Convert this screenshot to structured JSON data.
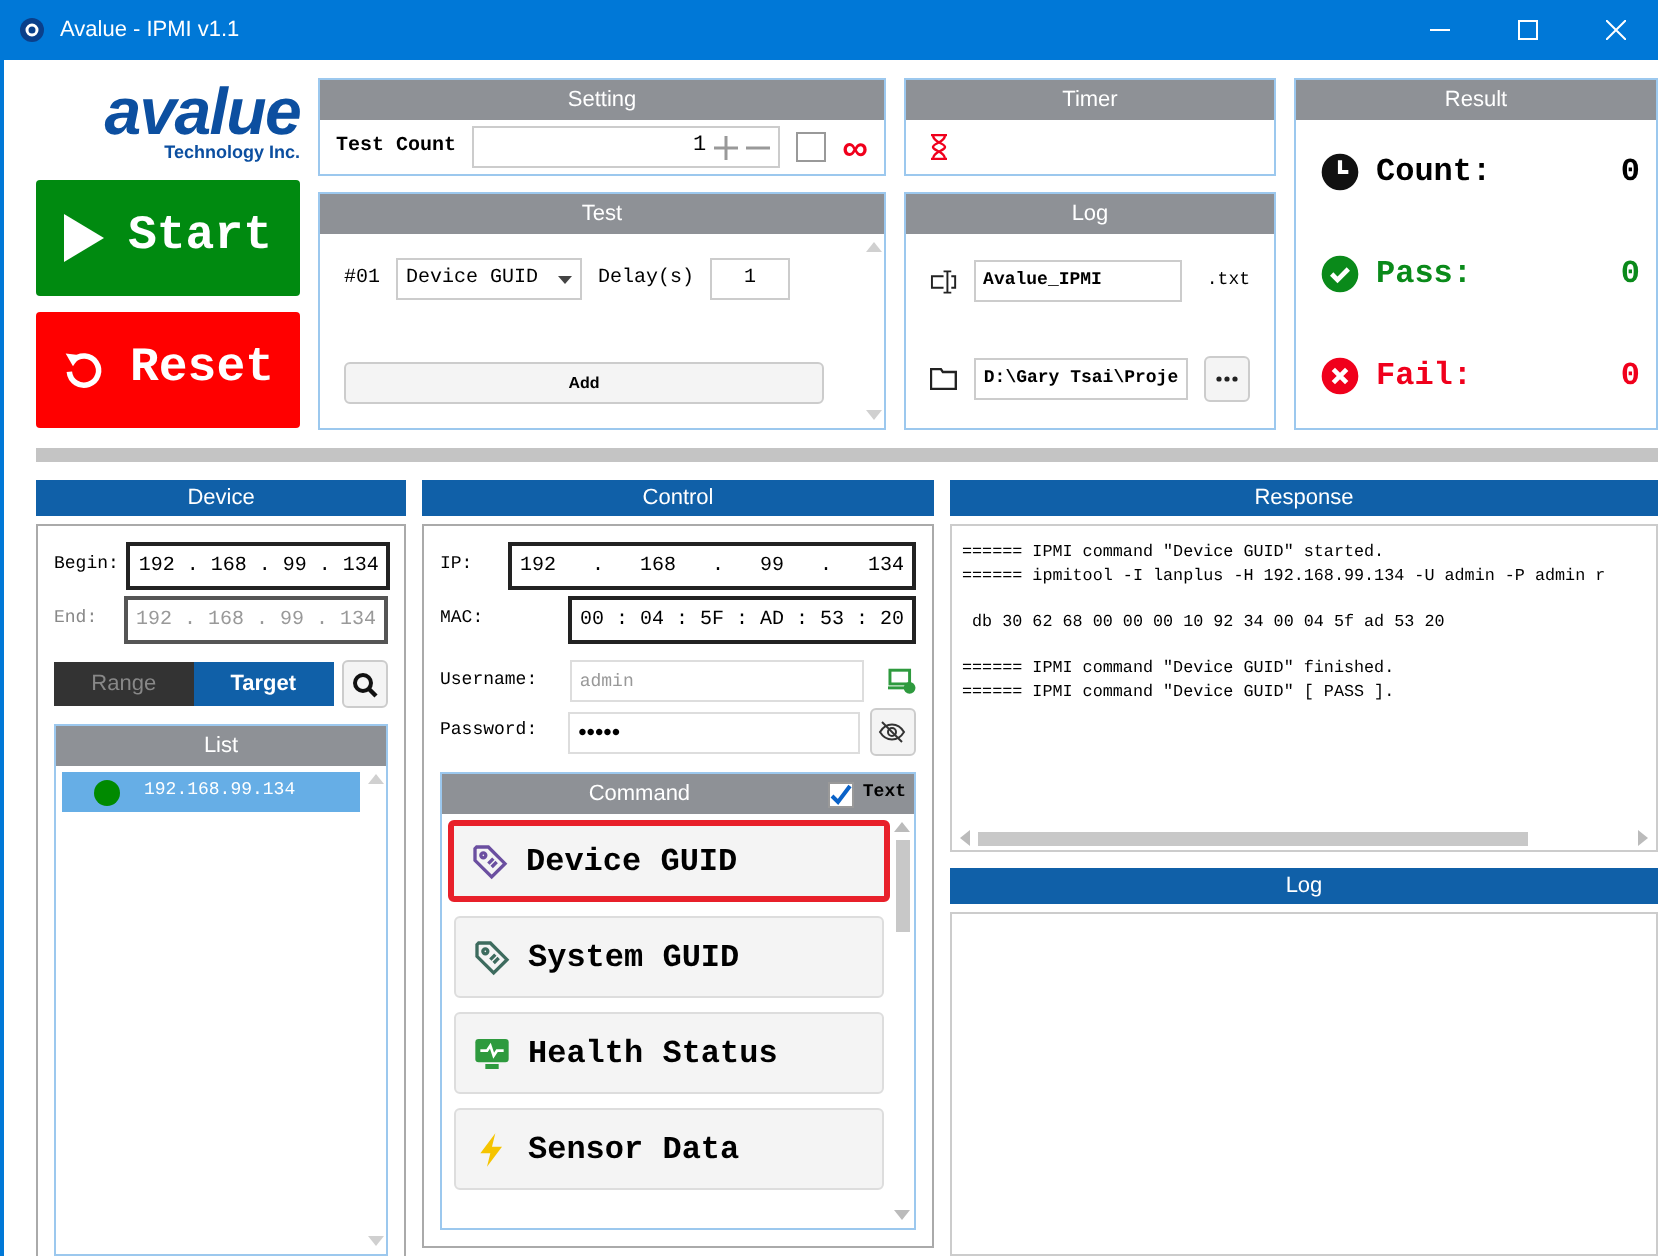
{
  "window": {
    "title": "Avalue - IPMI v1.1"
  },
  "logo": {
    "name": "avalue",
    "tagline": "Technology Inc."
  },
  "actions": [
    {
      "kind": "start",
      "label": "Start"
    },
    {
      "kind": "reset",
      "label": "Reset"
    }
  ],
  "setting": {
    "title": "Setting",
    "test_count_label": "Test Count",
    "test_count": "1",
    "infinite_checked": false,
    "infinite_symbol": "∞"
  },
  "test": {
    "title": "Test",
    "index": "#01",
    "command": "Device GUID",
    "delay_label": "Delay(s)",
    "delay": "1",
    "add": "Add"
  },
  "timer": {
    "title": "Timer"
  },
  "log": {
    "title": "Log",
    "file_name": "Avalue_IPMI",
    "extension": ".txt",
    "folder": "D:\\Gary Tsai\\Proje"
  },
  "result": {
    "title": "Result",
    "rows": [
      {
        "kind": "count",
        "label": "Count:",
        "value": "0"
      },
      {
        "kind": "pass",
        "label": "Pass:",
        "value": "0"
      },
      {
        "kind": "fail",
        "label": "Fail:",
        "value": "0"
      }
    ]
  },
  "device": {
    "title": "Device",
    "begin_label": "Begin:",
    "begin": "192 . 168 . 99 . 134",
    "end_label": "End:",
    "end": "192 . 168 . 99 . 134",
    "end_disabled": true,
    "modes": [
      {
        "label": "Range",
        "selected": false
      },
      {
        "label": "Target",
        "selected": true
      }
    ],
    "list": {
      "title": "List",
      "items": [
        {
          "address": "192.168.99.134",
          "color": "#008a00",
          "selected": true
        }
      ]
    }
  },
  "control": {
    "title": "Control",
    "ip_label": "IP:",
    "ip": "192   .   168   .   99   .   134",
    "mac_label": "MAC:",
    "mac": "00 : 04 : 5F : AD : 53 : 20",
    "username_label": "Username:",
    "username_placeholder": "admin",
    "password_label": "Password:",
    "password": "•••••",
    "command": {
      "title": "Command",
      "text_label": "Text",
      "text_checked": true,
      "items": [
        {
          "kind": "tag",
          "color": "#6b4fa0",
          "label": "Device GUID",
          "selected": true
        },
        {
          "kind": "tag",
          "color": "#3d6b5e",
          "label": "System GUID",
          "selected": false
        },
        {
          "kind": "monitor",
          "color": "#2e9a3e",
          "label": "Health Status",
          "selected": false
        },
        {
          "kind": "bolt",
          "color": "#f5c400",
          "label": "Sensor Data",
          "selected": false
        }
      ]
    }
  },
  "response": {
    "title": "Response",
    "groups": [
      [
        "====== IPMI command \"Device GUID\" started.",
        "====== ipmitool -I lanplus -H 192.168.99.134 -U admin -P admin r"
      ],
      [
        " db 30 62 68 00 00 00 10 92 34 00 04 5f ad 53 20"
      ],
      [
        "====== IPMI command \"Device GUID\" finished.",
        "====== IPMI command \"Device GUID\" [ PASS ]."
      ]
    ]
  },
  "log_panel": {
    "title": "Log"
  }
}
